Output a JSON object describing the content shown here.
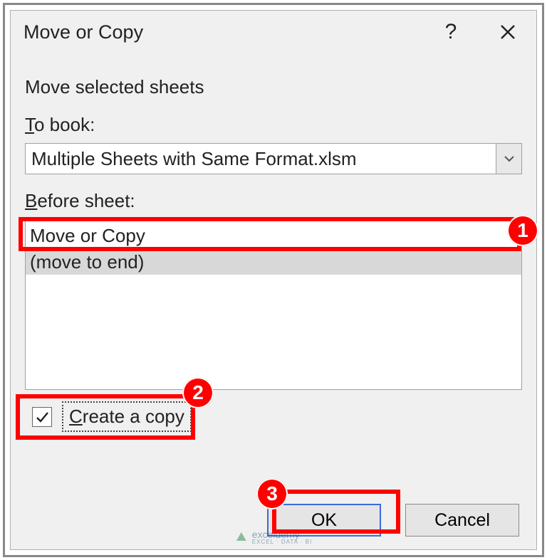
{
  "dialog": {
    "title": "Move or Copy",
    "subtitle": "Move selected sheets",
    "to_book_label": "To book:",
    "to_book_value": "Multiple Sheets with Same Format.xlsm",
    "before_sheet_label": "Before sheet:",
    "sheet_list": {
      "items": [
        "Move or Copy",
        "(move to end)"
      ],
      "selected_index": 1
    },
    "create_copy_label": "Create a copy",
    "create_copy_checked": true,
    "buttons": {
      "ok": "OK",
      "cancel": "Cancel"
    }
  },
  "annotations": {
    "badge1": "1",
    "badge2": "2",
    "badge3": "3"
  },
  "watermark": {
    "brand": "exceldemy",
    "tag": "EXCEL · DATA · BI"
  }
}
